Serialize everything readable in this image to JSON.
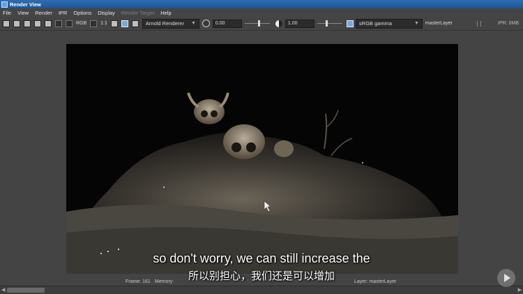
{
  "window": {
    "title": "Render View"
  },
  "menu": {
    "items": [
      "File",
      "View",
      "Render",
      "IPR",
      "Options",
      "Display",
      "Render Target",
      "Help"
    ]
  },
  "toolbar": {
    "ratio_label": "1:1",
    "rgb_label": "RGB",
    "renderer": "Arnold Renderer",
    "exposure_value": "0.00",
    "gamma_value": "1.00",
    "color_space": "sRGB gamma",
    "layer": "masterLayer",
    "ipr_memory": "IPR: 0MB"
  },
  "status": {
    "frame": "Frame: 161",
    "memory": "Memory:",
    "layer": "Layer: masterLayer"
  },
  "subtitles": {
    "english": "so don't worry, we can still increase the",
    "chinese": "所以别担心，我们还是可以增加"
  },
  "colors": {
    "titlebar": "#2d6db0",
    "background": "#444444",
    "render_bg": "#060606"
  }
}
